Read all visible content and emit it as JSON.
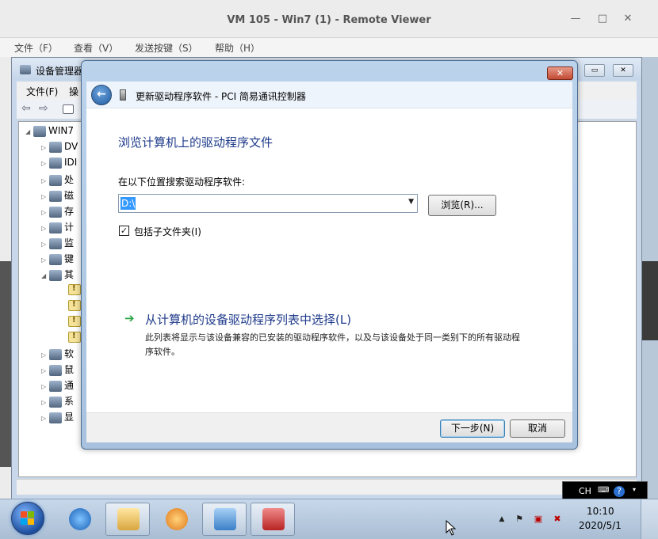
{
  "host": {
    "title": "VM 105 - Win7 (1) - Remote Viewer",
    "controls": [
      "—",
      "□",
      "✕"
    ],
    "menu": [
      "文件（F）",
      "查看（V）",
      "发送按键（S）",
      "帮助（H）"
    ]
  },
  "device_manager": {
    "title": "设备管理器",
    "menu": [
      "文件(F)",
      "操"
    ],
    "root": "WIN7",
    "nodes": [
      "DV",
      "IDI",
      "处",
      "磁",
      "存",
      "计",
      "监",
      "键",
      "其",
      "软",
      "鼠",
      "通",
      "系",
      "显"
    ]
  },
  "wizard": {
    "header_title": "更新驱动程序软件 - PCI 简易通讯控制器",
    "heading": "浏览计算机上的驱动程序文件",
    "search_label": "在以下位置搜索驱动程序软件:",
    "path_value": "D:\\",
    "browse_label": "浏览(R)...",
    "include_subfolders_label": "包括子文件夹(I)",
    "include_subfolders_checked": "✓",
    "pick_from_list_title": "从计算机的设备驱动程序列表中选择(L)",
    "pick_from_list_desc": "此列表将显示与该设备兼容的已安装的驱动程序软件，以及与该设备处于同一类别下的所有驱动程序软件。",
    "next_label": "下一步(N)",
    "cancel_label": "取消"
  },
  "tray_popup": {
    "lang": "CH",
    "help": "?"
  },
  "taskbar": {
    "time": "10:10",
    "date": "2020/5/1"
  },
  "colors": {
    "accent_link": "#1e3a8a",
    "green_arrow": "#2aa344",
    "selection": "#3399ff"
  }
}
